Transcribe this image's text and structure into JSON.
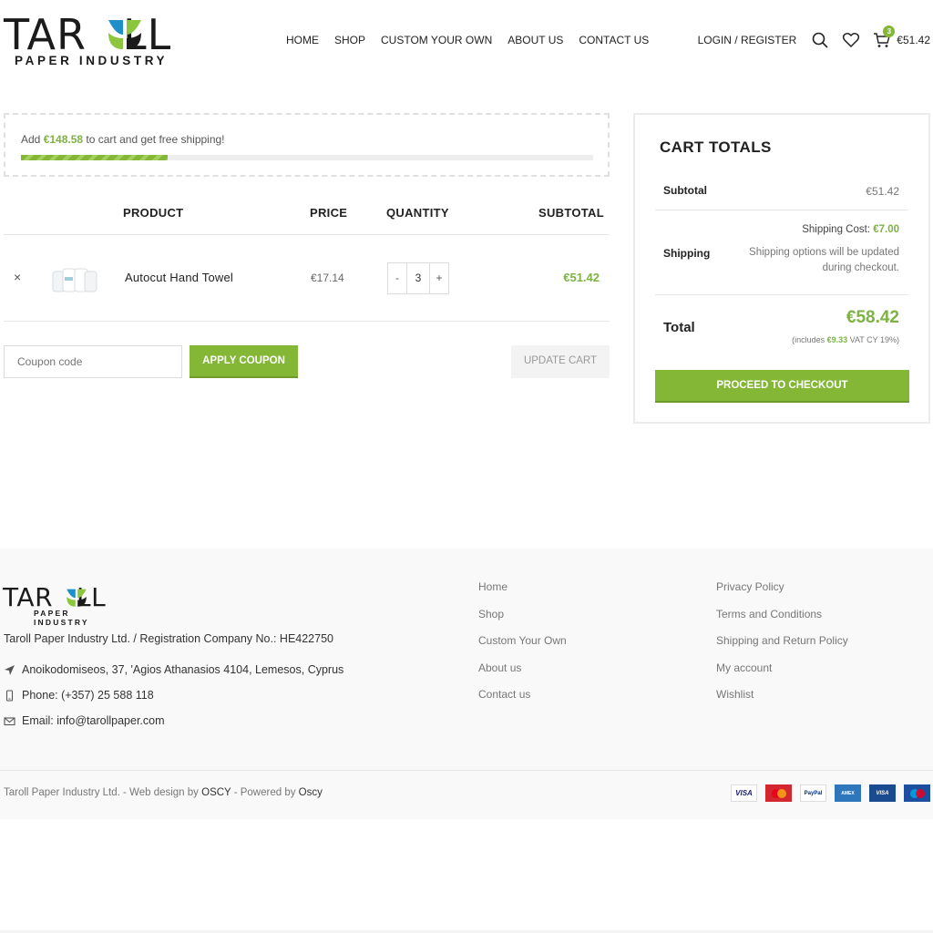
{
  "brand": {
    "name": "TAROLL",
    "tagline": "PAPER INDUSTRY"
  },
  "nav": {
    "items": [
      "HOME",
      "SHOP",
      "CUSTOM YOUR OWN",
      "ABOUT US",
      "CONTACT US"
    ]
  },
  "header": {
    "login": "LOGIN / REGISTER",
    "cart_count": "3",
    "cart_total": "€51.42"
  },
  "free_shipping": {
    "prefix": "Add ",
    "amount": "€148.58",
    "suffix": " to cart and get free shipping!",
    "progress_percent": 25.7
  },
  "table": {
    "headers": {
      "product": "PRODUCT",
      "price": "PRICE",
      "quantity": "QUANTITY",
      "subtotal": "SUBTOTAL"
    },
    "items": [
      {
        "remove": "×",
        "name": "Autocut Hand Towel",
        "price": "€17.14",
        "quantity": "3",
        "minus": "-",
        "plus": "+",
        "subtotal": "€51.42"
      }
    ]
  },
  "coupon": {
    "placeholder": "Coupon code",
    "apply_label": "APPLY COUPON",
    "update_label": "UPDATE CART"
  },
  "totals": {
    "title": "CART TOTALS",
    "subtotal_label": "Subtotal",
    "subtotal_value": "€51.42",
    "shipping_label": "Shipping",
    "shipping_cost_label": "Shipping Cost: ",
    "shipping_cost_value": "€7.00",
    "shipping_note": "Shipping options will be updated during checkout.",
    "total_label": "Total",
    "total_value": "€58.42",
    "vat_prefix": "(includes ",
    "vat_amount": "€9.33",
    "vat_suffix": " VAT CY 19%)",
    "checkout_label": "PROCEED TO CHECKOUT"
  },
  "footer": {
    "registration": "Taroll Paper Industry Ltd. / Registration Company No.: HE422750",
    "address": "Anoikodomiseos, 37, 'Agios Athanasios 4104, Lemesos, Cyprus",
    "phone": "Phone: (+357) 25 588 118",
    "email": "Email: info@tarollpaper.com",
    "links_col1": [
      "Home",
      "Shop",
      "Custom Your Own",
      "About us",
      "Contact us"
    ],
    "links_col2": [
      "Privacy Policy",
      "Terms and Conditions",
      "Shipping and Return Policy",
      "My account",
      "Wishlist"
    ],
    "copyright_prefix": "Taroll Paper Industry Ltd. - Web design by ",
    "copyright_design": "OSCY",
    "copyright_mid": " - Powered by ",
    "copyright_power": "Oscy",
    "payment_cards": [
      "VISA",
      "MasterCard",
      "PayPal",
      "American Express",
      "VISA Electron",
      "Maestro"
    ]
  },
  "colors": {
    "accent": "#83b735",
    "leaf_blue": "#1f8fc9",
    "leaf_green": "#8cc63f",
    "text_dark": "#222222"
  }
}
